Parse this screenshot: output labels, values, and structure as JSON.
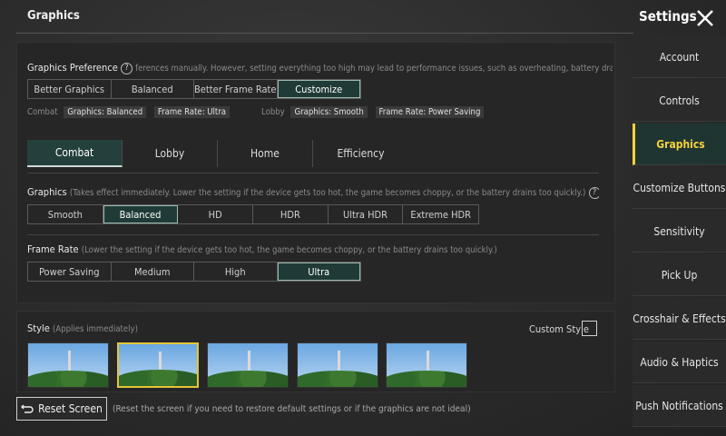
{
  "header": {
    "title": "Graphics",
    "settings_title": "Settings"
  },
  "sidebar": {
    "items": [
      {
        "label": "Account"
      },
      {
        "label": "Controls"
      },
      {
        "label": "Graphics"
      },
      {
        "label": "Customize Buttons"
      },
      {
        "label": "Sensitivity"
      },
      {
        "label": "Pick Up"
      },
      {
        "label": "Crosshair & Effects"
      },
      {
        "label": "Audio & Haptics"
      },
      {
        "label": "Push Notifications"
      }
    ],
    "active": "Graphics"
  },
  "graphics_preference": {
    "label": "Graphics Preference",
    "help": "?",
    "note": "ferences manually. However, setting everything too high may lead to performance issues, such as overheating, battery drain, or c",
    "options": [
      "Better Graphics",
      "Balanced",
      "Better Frame Rate",
      "Customize"
    ],
    "selected": "Customize",
    "combat_label": "Combat",
    "combat_graphics": "Graphics: Balanced",
    "combat_fps": "Frame Rate: Ultra",
    "lobby_label": "Lobby",
    "lobby_graphics": "Graphics: Smooth",
    "lobby_fps": "Frame Rate: Power Saving"
  },
  "tabs": {
    "items": [
      "Combat",
      "Lobby",
      "Home",
      "Efficiency"
    ],
    "active": "Combat"
  },
  "graphics": {
    "label": "Graphics",
    "note": "(Takes effect immediately. Lower the setting if the device gets too hot, the game becomes choppy, or the battery drains too quickly.)",
    "help": "?",
    "options": [
      "Smooth",
      "Balanced",
      "HD",
      "HDR",
      "Ultra HDR",
      "Extreme HDR"
    ],
    "selected": "Balanced"
  },
  "frame_rate": {
    "label": "Frame Rate",
    "note": "(Lower the setting if the device gets too hot, the game becomes choppy, or the battery drains too quickly.)",
    "options": [
      "Power Saving",
      "Medium",
      "High",
      "Ultra"
    ],
    "selected": "Ultra"
  },
  "style": {
    "label": "Style",
    "note": "(Applies immediately)",
    "custom_style_label": "Custom Style",
    "selected_index": 1,
    "count": 5
  },
  "footer": {
    "reset_label": "Reset Screen",
    "reset_note": "(Reset the screen if you need to restore default settings or if the graphics are not ideal)"
  },
  "colors": {
    "accent": "#f5d13a",
    "selected_bg": "#203b37"
  }
}
